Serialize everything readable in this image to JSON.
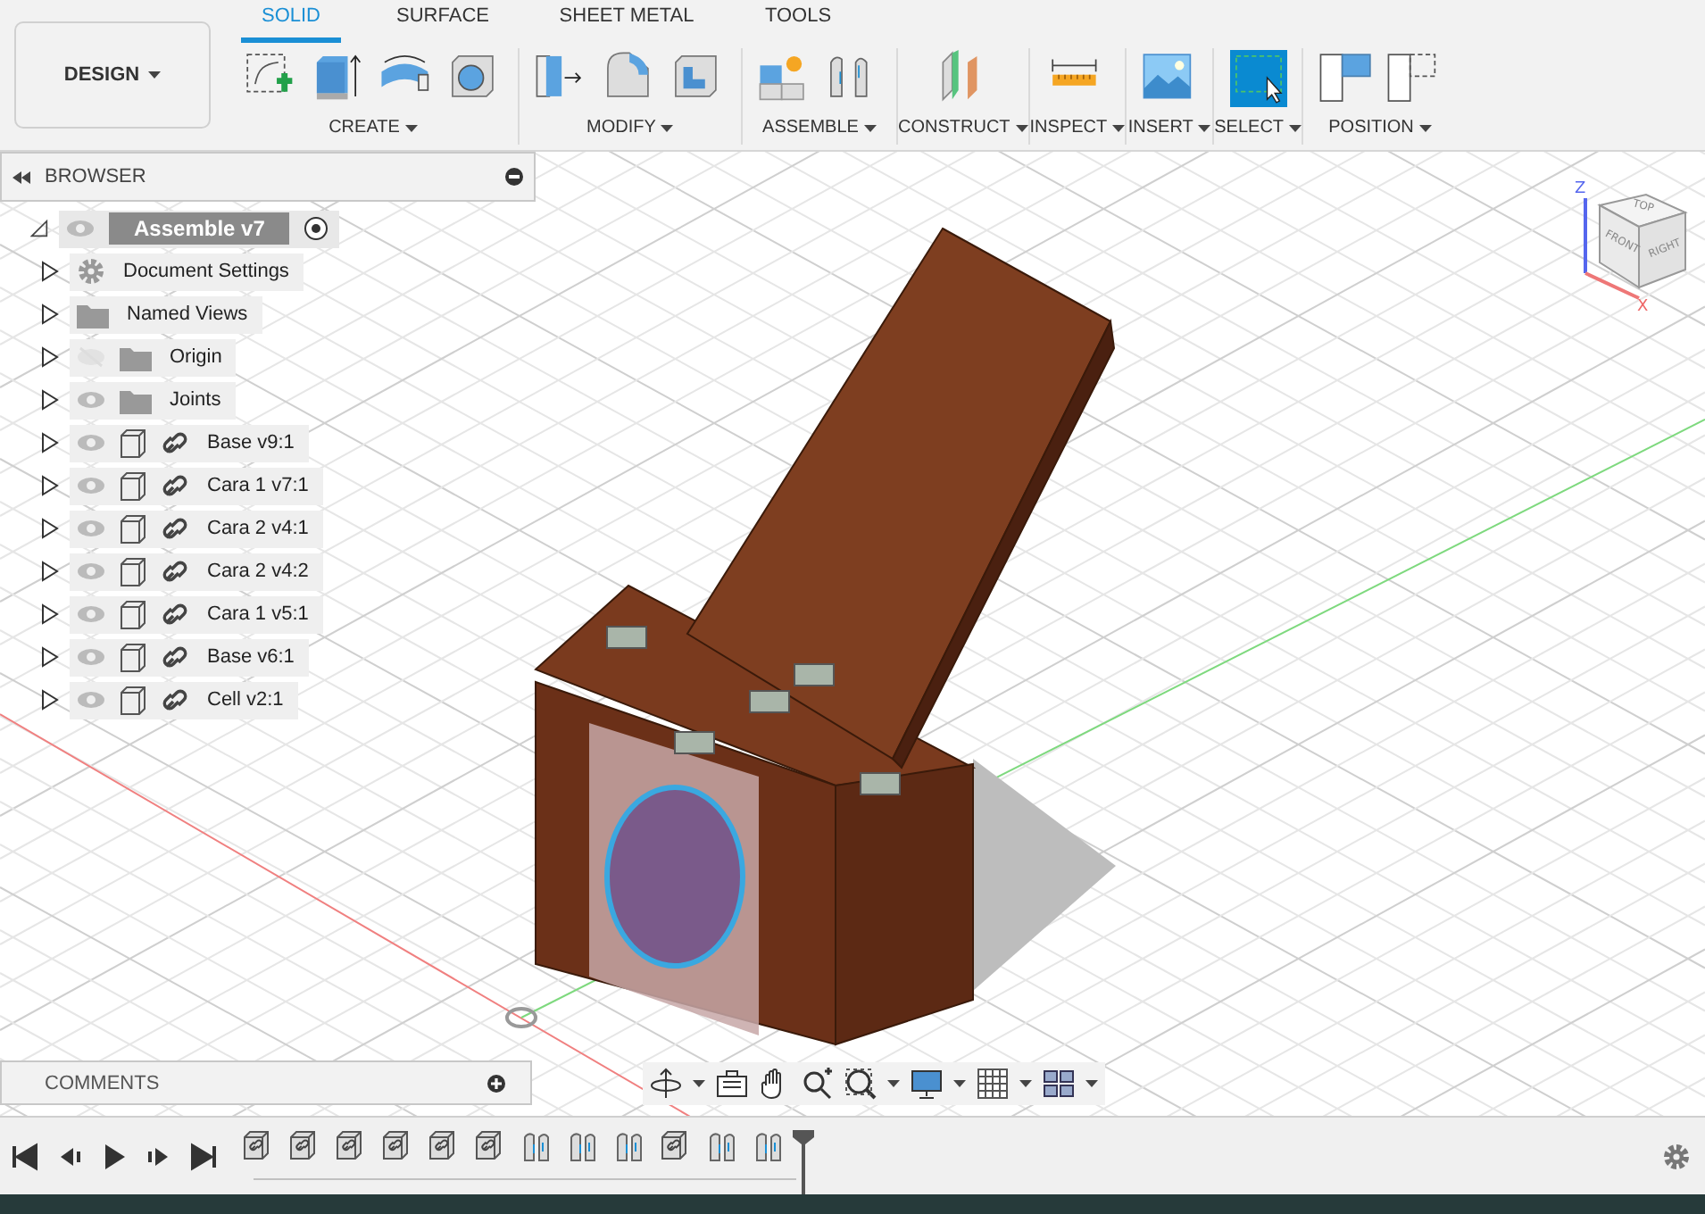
{
  "workspace": {
    "label": "DESIGN"
  },
  "tabs": [
    {
      "label": "SOLID",
      "selected": true
    },
    {
      "label": "SURFACE",
      "selected": false
    },
    {
      "label": "SHEET METAL",
      "selected": false
    },
    {
      "label": "TOOLS",
      "selected": false
    }
  ],
  "tool_groups": [
    {
      "label": "CREATE",
      "tools": [
        {
          "kind": "sketch"
        },
        {
          "kind": "extrude"
        },
        {
          "kind": "revolve"
        },
        {
          "kind": "hole"
        }
      ]
    },
    {
      "label": "MODIFY",
      "tools": [
        {
          "kind": "presspull"
        },
        {
          "kind": "fillet"
        },
        {
          "kind": "shell"
        }
      ]
    },
    {
      "label": "ASSEMBLE",
      "tools": [
        {
          "kind": "component"
        },
        {
          "kind": "joint"
        }
      ]
    },
    {
      "label": "CONSTRUCT",
      "tools": [
        {
          "kind": "plane"
        }
      ]
    },
    {
      "label": "INSPECT",
      "tools": [
        {
          "kind": "measure"
        }
      ]
    },
    {
      "label": "INSERT",
      "tools": [
        {
          "kind": "image"
        }
      ]
    },
    {
      "label": "SELECT",
      "tools": [
        {
          "kind": "select"
        }
      ]
    },
    {
      "label": "POSITION",
      "tools": [
        {
          "kind": "position"
        },
        {
          "kind": "capture"
        }
      ]
    }
  ],
  "browser": {
    "title": "BROWSER",
    "root": {
      "label": "Assemble v7",
      "expanded": true,
      "children": [
        {
          "kind": "settings",
          "label": "Document Settings"
        },
        {
          "kind": "folder",
          "label": "Named Views"
        },
        {
          "kind": "folder",
          "label": "Origin",
          "visible": false
        },
        {
          "kind": "folder",
          "label": "Joints",
          "visible": true
        },
        {
          "kind": "component",
          "label": "Base v9:1",
          "visible": true
        },
        {
          "kind": "component",
          "label": "Cara 1 v7:1",
          "visible": true
        },
        {
          "kind": "component",
          "label": "Cara 2 v4:1",
          "visible": true
        },
        {
          "kind": "component",
          "label": "Cara 2 v4:2",
          "visible": true
        },
        {
          "kind": "component",
          "label": "Cara 1 v5:1",
          "visible": true
        },
        {
          "kind": "component",
          "label": "Base v6:1",
          "visible": true
        },
        {
          "kind": "component",
          "label": "Cell v2:1",
          "visible": true
        }
      ]
    }
  },
  "comments": {
    "title": "COMMENTS"
  },
  "viewcube": {
    "faces": [
      "TOP",
      "FRONT",
      "RIGHT"
    ],
    "axes": [
      "Z",
      "X"
    ]
  },
  "nav_tools": [
    {
      "kind": "orbit",
      "menu": true
    },
    {
      "kind": "look"
    },
    {
      "kind": "pan"
    },
    {
      "kind": "zoom"
    },
    {
      "kind": "fit",
      "menu": true
    },
    {
      "kind": "display",
      "menu": true
    },
    {
      "kind": "grid",
      "menu": true
    },
    {
      "kind": "viewports",
      "menu": true
    }
  ],
  "timeline": {
    "items": [
      {
        "kind": "component"
      },
      {
        "kind": "component"
      },
      {
        "kind": "component"
      },
      {
        "kind": "component"
      },
      {
        "kind": "component"
      },
      {
        "kind": "component"
      },
      {
        "kind": "joint"
      },
      {
        "kind": "joint"
      },
      {
        "kind": "joint"
      },
      {
        "kind": "component"
      },
      {
        "kind": "joint"
      },
      {
        "kind": "joint"
      }
    ]
  }
}
